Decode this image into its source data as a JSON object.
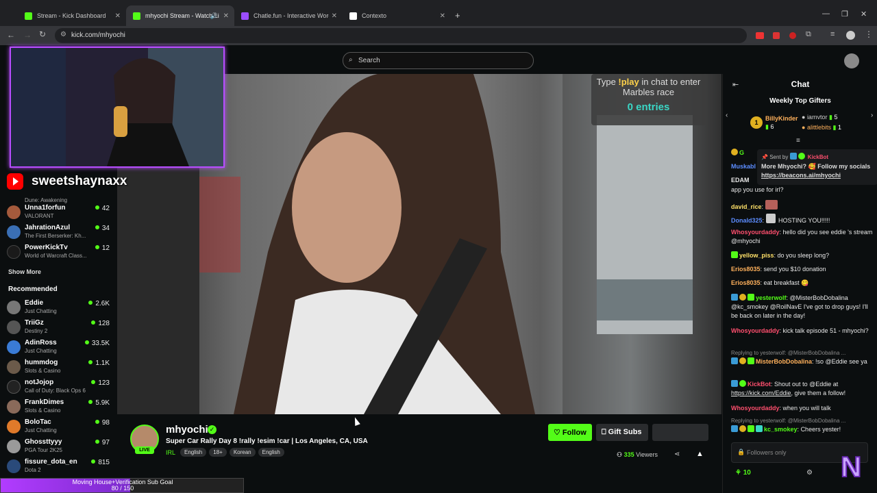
{
  "browser": {
    "tabs": [
      {
        "label": "Stream - Kick Dashboard",
        "color": "#53fc18"
      },
      {
        "label": "mhyochi Stream - Watch Li",
        "color": "#53fc18"
      },
      {
        "label": "Chatle.fun - Interactive Wordle",
        "color": "#9b4dff"
      },
      {
        "label": "Contexto",
        "color": "#ffffff"
      }
    ],
    "url": "kick.com/mhyochi"
  },
  "search": {
    "placeholder": "Search"
  },
  "overlay": {
    "channel": "sweetshaynaxx",
    "goal": {
      "label": "Moving House+Verification Sub Goal",
      "progress_text": "80 / 150",
      "fraction": 0.533
    }
  },
  "marbles": {
    "line1_pre": "Type ",
    "cmd": "!play",
    "line1_post": " in chat to enter",
    "line2": "Marbles race",
    "entries": "0 entries"
  },
  "sidebar": {
    "following": [
      {
        "name": "Dune: Awakening",
        "game": "",
        "viewers": ""
      },
      {
        "name": "Unna1forfun",
        "game": "VALORANT",
        "viewers": "42"
      },
      {
        "name": "JahrationAzul",
        "game": "The First Berserker: Kh...",
        "viewers": "34"
      },
      {
        "name": "PowerKickTv",
        "game": "World of Warcraft Class...",
        "viewers": "12"
      }
    ],
    "show_more": "Show More",
    "recommended_title": "Recommended",
    "recommended": [
      {
        "name": "Eddie",
        "game": "Just Chatting",
        "viewers": "2.6K"
      },
      {
        "name": "TriiGz",
        "game": "Destiny 2",
        "viewers": "128"
      },
      {
        "name": "AdinRoss",
        "game": "Just Chatting",
        "viewers": "33.5K"
      },
      {
        "name": "hummdog",
        "game": "Slots & Casino",
        "viewers": "1.1K"
      },
      {
        "name": "notJojop",
        "game": "Call of Duty: Black Ops 6",
        "viewers": "123"
      },
      {
        "name": "FrankDimes",
        "game": "Slots & Casino",
        "viewers": "5.9K"
      },
      {
        "name": "BoloTac",
        "game": "Just Chatting",
        "viewers": "98"
      },
      {
        "name": "Ghossttyyy",
        "game": "PGA Tour 2K25",
        "viewers": "97"
      },
      {
        "name": "fissure_dota_en",
        "game": "Dota 2",
        "viewers": "815"
      }
    ]
  },
  "stream": {
    "channel": "mhyochi",
    "live": "LIVE",
    "title": "Super Car Rally Day 8 !rally !esim !car | Los Angeles, CA, USA",
    "category": "IRL",
    "tags": [
      "English",
      "18+",
      "Korean",
      "English"
    ],
    "follow": "Follow",
    "gift": "Gift Subs",
    "viewers": "335",
    "viewers_label": "Viewers"
  },
  "chat": {
    "title": "Chat",
    "gifters_title": "Weekly Top Gifters",
    "gifters": [
      {
        "rank": "1",
        "name": "BillyKinder",
        "count": "6"
      },
      {
        "name": "iamvtor",
        "count": "5"
      },
      {
        "name": "alittlebits",
        "count": "1"
      }
    ],
    "pinned": {
      "sent_by": "Sent by",
      "bot": "KickBot",
      "text": "More Mhyochi? 🥰 Follow my socials",
      "link": "https://beacons.ai/mhyochi"
    },
    "partial": [
      "Muskabl",
      "EDAM",
      "app you use for irl?"
    ],
    "messages": [
      {
        "user": "david_rice",
        "color": "#ffe169",
        "text": ""
      },
      {
        "user": "Donald325",
        "color": "#5c8dff",
        "text": "HOSTING YOU!!!!!"
      },
      {
        "user": "Whosyourdaddy",
        "color": "#ff4f6e",
        "text": "hello did you see eddie 's stream @mhyochi"
      },
      {
        "user": "yellow_piss",
        "color": "#ffe169",
        "text": "do you sleep long?"
      },
      {
        "user": "Erios8035",
        "color": "#ffb15c",
        "text": "send you $10 donation"
      },
      {
        "user": "Erios8035",
        "color": "#ffb15c",
        "text": "eat breakfast 😋"
      },
      {
        "user": "yesterwolf",
        "color": "#53fc18",
        "text": "@MisterBobDobalina @kc_smokey @RoilNavE I've got to drop guys! I'll be back on later in the day!"
      },
      {
        "user": "Whosyourdaddy",
        "color": "#ff4f6e",
        "text": "kick talk episode 51 - mhyochi?"
      },
      {
        "reply": "Replying to yesterwolf: @MisterBobDobalina ...",
        "user": "MisterBobDobalina",
        "color": "#ffb15c",
        "text": "!so @Eddie see ya"
      },
      {
        "user": "KickBot",
        "color": "#ff4f6e",
        "text": "Shout out to @Eddie at",
        "link": "https://kick.com/Eddie",
        "tail": ", give them a follow!"
      },
      {
        "user": "Whosyourdaddy",
        "color": "#ff4f6e",
        "text": "when you will talk"
      },
      {
        "reply": "Replying to yesterwolf: @MisterBobDobalina ...",
        "user": "kc_smokey",
        "color": "#53fc18",
        "text": "Cheers yester!"
      }
    ],
    "input_placeholder": "Followers only",
    "points": "10"
  },
  "colors": {
    "accent": "#53fc18",
    "overlay_border": "#b84dff"
  }
}
